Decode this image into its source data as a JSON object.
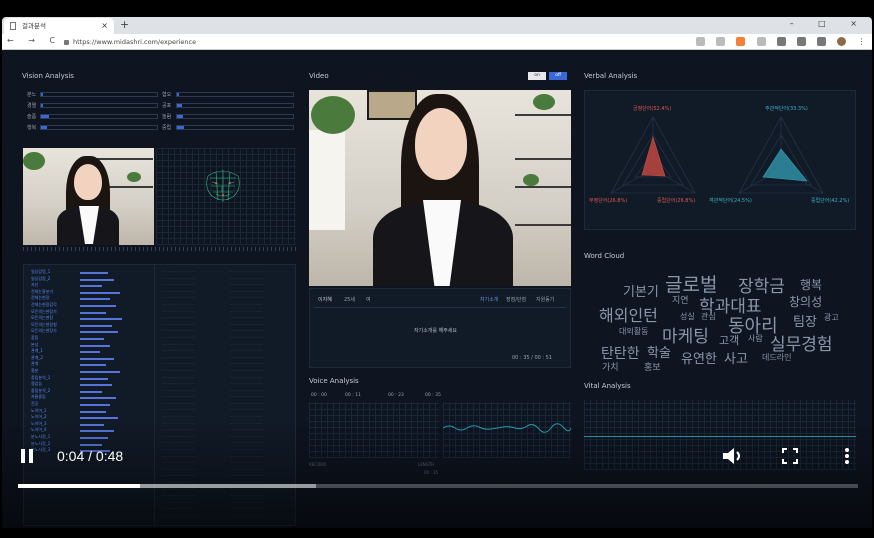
{
  "browser": {
    "tab_title": "걸과분석",
    "tab_close": "×",
    "new_tab": "+",
    "window_controls": "–  □  ×",
    "nav_buttons": "←  →  C",
    "url": "https://www.midashri.com/experience"
  },
  "vision": {
    "title": "Vision Analysis",
    "emotions_left": [
      {
        "label": "분노",
        "value": 0.02
      },
      {
        "label": "경멸",
        "value": 0.02
      },
      {
        "label": "슬픔",
        "value": 0.07
      },
      {
        "label": "행복",
        "value": 0.05
      }
    ],
    "emotions_right": [
      {
        "label": "혐오",
        "value": 0.02
      },
      {
        "label": "공포",
        "value": 0.04
      },
      {
        "label": "놀람",
        "value": 0.05
      },
      {
        "label": "중립",
        "value": 0.06
      }
    ],
    "competency_items": [
      "일상감정_1",
      "일상감정_2",
      "자신",
      "전체는흥분가",
      "전체는현장",
      "전체는현장감각",
      "모든의는현장가",
      "모든의는현장",
      "모든의는현장형",
      "모든의는현장가",
      "중립",
      "본성",
      "관계_1",
      "관계_2",
      "관계",
      "흥분",
      "중립분석_1",
      "협업능",
      "중립분석_2",
      "자율중립",
      "전공",
      "노이어_1",
      "노이어_2",
      "노이어_3",
      "노이어_4",
      "분노사정_1",
      "분노사정_2",
      "분노사정_3"
    ]
  },
  "video": {
    "title": "Video",
    "toggle_off": "on",
    "toggle_on": "off",
    "applicant": "이지혜",
    "age": "25세",
    "gender": "여",
    "tabs": [
      "자기소개",
      "장점/단점",
      "지원동기"
    ],
    "prompt": "자기소개를 해주세요",
    "timer": "00 : 35 / 00 : 51"
  },
  "voice": {
    "title": "Voice Analysis",
    "times": [
      "00 : 00",
      "00 : 11",
      "00 : 23",
      "00 : 35"
    ],
    "label_left": "RECORD",
    "label_right": "LENGTH",
    "label_right_val": "00 : 35"
  },
  "verbal": {
    "title": "Verbal Analysis",
    "left_radar": {
      "top": "긍정단어(52.4%)",
      "left": "부정단어(26.8%)",
      "right": "중립단어(26.8%)"
    },
    "right_radar": {
      "top": "주관적단어(33.3%)",
      "left": "객관적단어(24.5%)",
      "right": "중립단어(42.2%)"
    }
  },
  "wordcloud": {
    "title": "Word Cloud",
    "words": [
      "기본기",
      "글로벌",
      "장학금",
      "행복",
      "지연",
      "학과대표",
      "창의성",
      "해외인턴",
      "성실",
      "관심",
      "동아리",
      "팀장",
      "광고",
      "대외활동",
      "마케팅",
      "고객",
      "사람",
      "실무경험",
      "탄탄한",
      "학술",
      "유연한",
      "사고",
      "데드라인",
      "가치",
      "홍보"
    ]
  },
  "vital": {
    "title": "Vital Analysis"
  },
  "player": {
    "time": "0:04 / 0:48",
    "played": 0.145,
    "buffered": 0.355
  },
  "colors": {
    "accent": "#3a69d6",
    "radar_left": "#e0594f",
    "radar_right": "#3fb3c7",
    "background": "#0e1420"
  }
}
